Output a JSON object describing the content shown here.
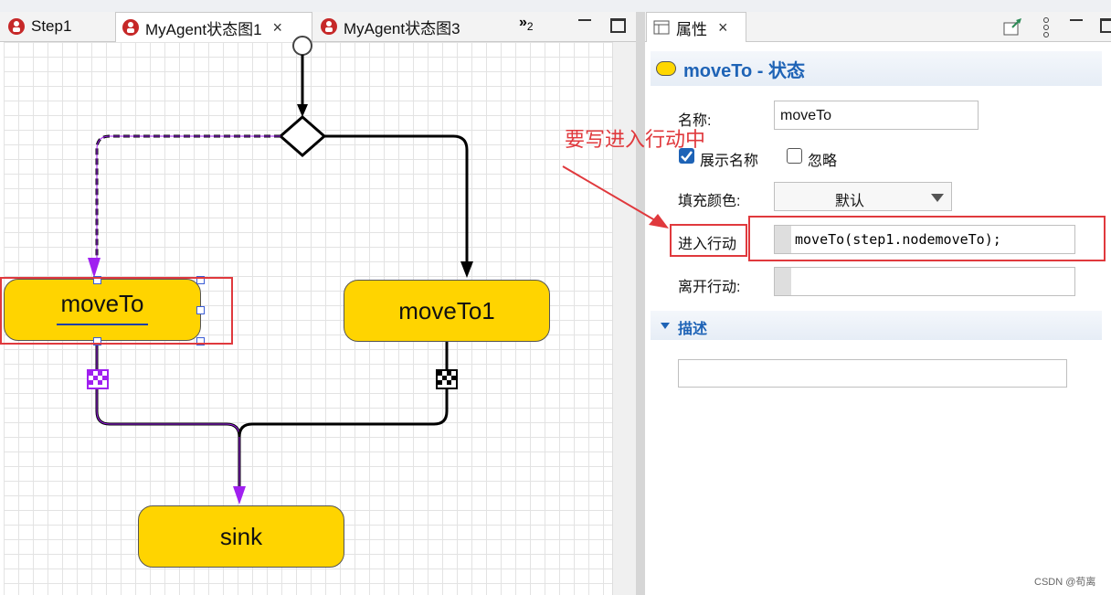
{
  "tabs": {
    "left": [
      {
        "label": "Step1"
      },
      {
        "label": "MyAgent状态图1",
        "close": "×"
      },
      {
        "label": "MyAgent状态图3"
      }
    ],
    "overflow": "»",
    "overflow_count": "2",
    "right_tab_label": "属性",
    "right_tab_close": "×"
  },
  "diagram": {
    "nodes": {
      "moveTo": "moveTo",
      "moveTo1": "moveTo1",
      "sink": "sink"
    }
  },
  "properties": {
    "header_title": "moveTo - 状态",
    "name_label": "名称:",
    "name_value": "moveTo",
    "show_name_label": "展示名称",
    "show_name_checked": true,
    "ignore_label": "忽略",
    "ignore_checked": false,
    "fill_label": "填充颜色:",
    "fill_value": "默认",
    "entry_label": "进入行动",
    "entry_value": "moveTo(step1.nodemoveTo);",
    "exit_label": "离开行动:",
    "exit_value": "",
    "desc_section": "描述",
    "desc_value": ""
  },
  "annotation": {
    "text": "要写进入行动中",
    "color": "#e0393d"
  },
  "watermark": "CSDN @苟离",
  "colors": {
    "node_fill": "#ffd400",
    "selection": "#a020f0",
    "accent": "#1e63b6"
  }
}
